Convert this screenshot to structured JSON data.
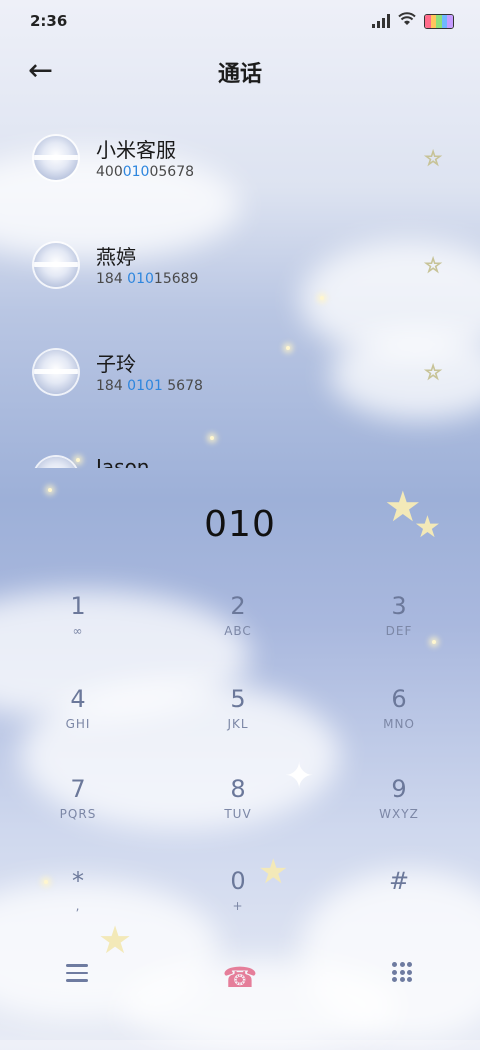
{
  "status_bar": {
    "time": "2:36"
  },
  "header": {
    "back_icon": "←",
    "title": "通话"
  },
  "contacts": [
    {
      "name": "小米客服",
      "number_parts": [
        "400",
        "010",
        "05678"
      ]
    },
    {
      "name": "燕婷",
      "number_parts": [
        "184 ",
        "010",
        "15689"
      ]
    },
    {
      "name": "子玲",
      "number_parts": [
        "184 ",
        "0101",
        " 5678"
      ]
    },
    {
      "name": "Jason",
      "number_parts": [
        "",
        "",
        ""
      ]
    }
  ],
  "favorite_icon": "☆",
  "dialed": "010",
  "keypad": [
    {
      "digit": "1",
      "letters": "∞"
    },
    {
      "digit": "2",
      "letters": "ABC"
    },
    {
      "digit": "3",
      "letters": "DEF"
    },
    {
      "digit": "4",
      "letters": "GHI"
    },
    {
      "digit": "5",
      "letters": "JKL"
    },
    {
      "digit": "6",
      "letters": "MNO"
    },
    {
      "digit": "7",
      "letters": "PQRS"
    },
    {
      "digit": "8",
      "letters": "TUV"
    },
    {
      "digit": "9",
      "letters": "WXYZ"
    },
    {
      "digit": "*",
      "letters": ","
    },
    {
      "digit": "0",
      "letters": "+"
    },
    {
      "digit": "#",
      "letters": ""
    }
  ],
  "bottom_bar": {
    "call_icon": "☎"
  },
  "colors": {
    "highlight": "#2e86de",
    "key_digit": "#6b789a"
  }
}
